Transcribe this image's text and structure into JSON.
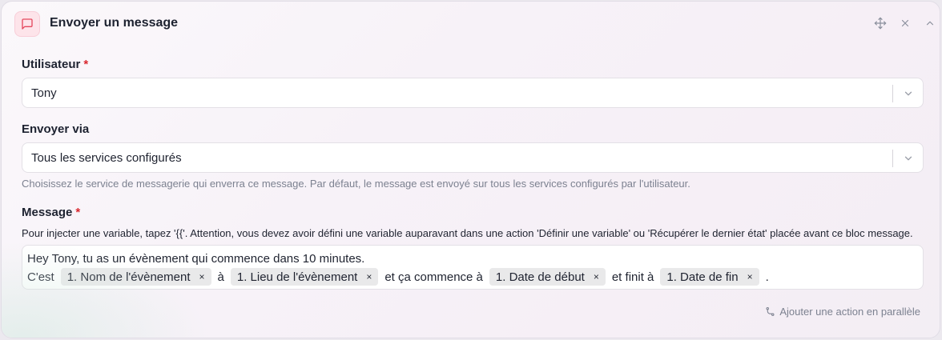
{
  "header": {
    "title": "Envoyer un message",
    "icon": "message-square-icon",
    "accent": "#e5485e"
  },
  "user_field": {
    "label": "Utilisateur",
    "required_mark": "*",
    "value": "Tony"
  },
  "send_via_field": {
    "label": "Envoyer via",
    "value": "Tous les services configurés",
    "help": "Choisissez le service de messagerie qui enverra ce message. Par défaut, le message est envoyé sur tous les services configurés par l'utilisateur."
  },
  "message_field": {
    "label": "Message",
    "required_mark": "*",
    "hint": "Pour injecter une variable, tapez '{{'. Attention, vous devez avoir défini une variable auparavant dans une action 'Définir une variable' ou 'Récupérer le dernier état' placée avant ce bloc message.",
    "line1": "Hey Tony, tu as un évènement qui commence dans 10 minutes.",
    "line2": {
      "t1": "C'est",
      "chip1": "1. Nom de l'évènement",
      "t2": "à",
      "chip2": "1. Lieu de l'évènement",
      "t3": "et ça commence à",
      "chip3": "1. Date de début",
      "t4": "et finit à",
      "chip4": "1. Date de fin",
      "t5": "."
    },
    "chip_remove": "×"
  },
  "footer": {
    "parallel_action": "Ajouter une action en parallèle"
  }
}
